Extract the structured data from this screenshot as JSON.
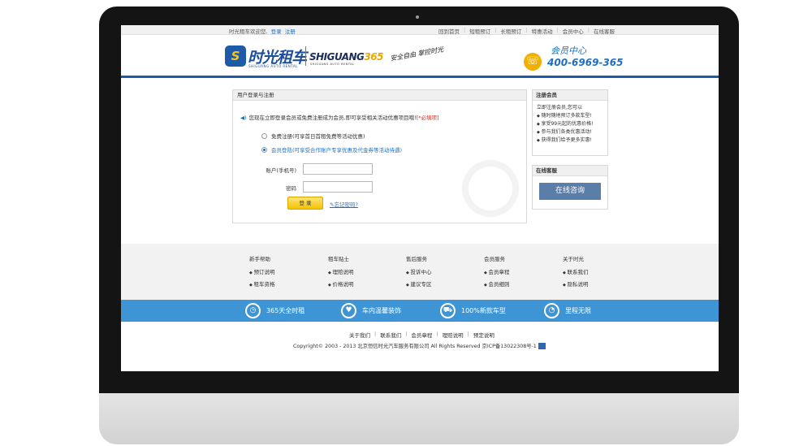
{
  "topbar": {
    "welcome": "时光租车欢迎您,",
    "login": "登录",
    "register": "注册",
    "links": [
      "回到首页",
      "短租预订",
      "长租预订",
      "特惠活动",
      "会员中心",
      "在线客服"
    ]
  },
  "header": {
    "logo_cn": "时光租车",
    "logo_sub": "SHIGUANG AUTO RENTAL",
    "logo365_text": "SHIGUANG",
    "logo365_num": "365",
    "logo365_sub": "SHIGUANG AUTO RENTAL",
    "slogan": "安全自由 掌控时光",
    "member_center": "会员中心",
    "phone": "400-6969-365"
  },
  "login": {
    "box_title": "用户登录与注册",
    "notice": "您现在立即登录会员或免费注册成为会员,即可享受相关活动优惠项目哦!",
    "required": "[*必填项]",
    "option1_label": "免费注册",
    "option1_note": "(可享首日首租免费等活动优惠)",
    "option2_label": "会员登陆",
    "option2_note": "(可享受合作账户专享优惠及代金券等活动待遇)",
    "account_label": "账户(手机号)",
    "password_label": "密码",
    "login_button": "登 录",
    "forgot": "忘记密码?"
  },
  "register_box": {
    "title": "注册会员",
    "intro": "立即注册会员,您可以",
    "items": [
      "随时随地预订多款车型!",
      "享受99元起的优惠价格!",
      "参与我们各类优惠活动!",
      "获得我们给予更多实惠!"
    ]
  },
  "service_box": {
    "title": "在线客服",
    "button": "在线咨询"
  },
  "footer": {
    "columns": [
      {
        "title": "新手帮助",
        "items": [
          "预订说明",
          "租车资格"
        ]
      },
      {
        "title": "租车贴士",
        "items": [
          "理赔说明",
          "价格说明"
        ]
      },
      {
        "title": "售后服务",
        "items": [
          "投诉中心",
          "建议专区"
        ]
      },
      {
        "title": "会员服务",
        "items": [
          "会员章程",
          "会员细则"
        ]
      },
      {
        "title": "关于时光",
        "items": [
          "联系我们",
          "隐私说明"
        ]
      }
    ],
    "features": [
      {
        "icon": "clock-icon",
        "label": "365天全时租"
      },
      {
        "icon": "heart-icon",
        "label": "车内温馨装饰"
      },
      {
        "icon": "car-icon",
        "label": "100%新款车型"
      },
      {
        "icon": "speedometer-icon",
        "label": "里程无限"
      }
    ],
    "bottom_links": [
      "关于我们",
      "联系我们",
      "会员章程",
      "理赔说明",
      "预定说明"
    ],
    "copyright": "Copyright© 2003 - 2013 北京恒信时光汽车服务有限公司 All Rights Reserved 京ICP备13022308号-1"
  }
}
